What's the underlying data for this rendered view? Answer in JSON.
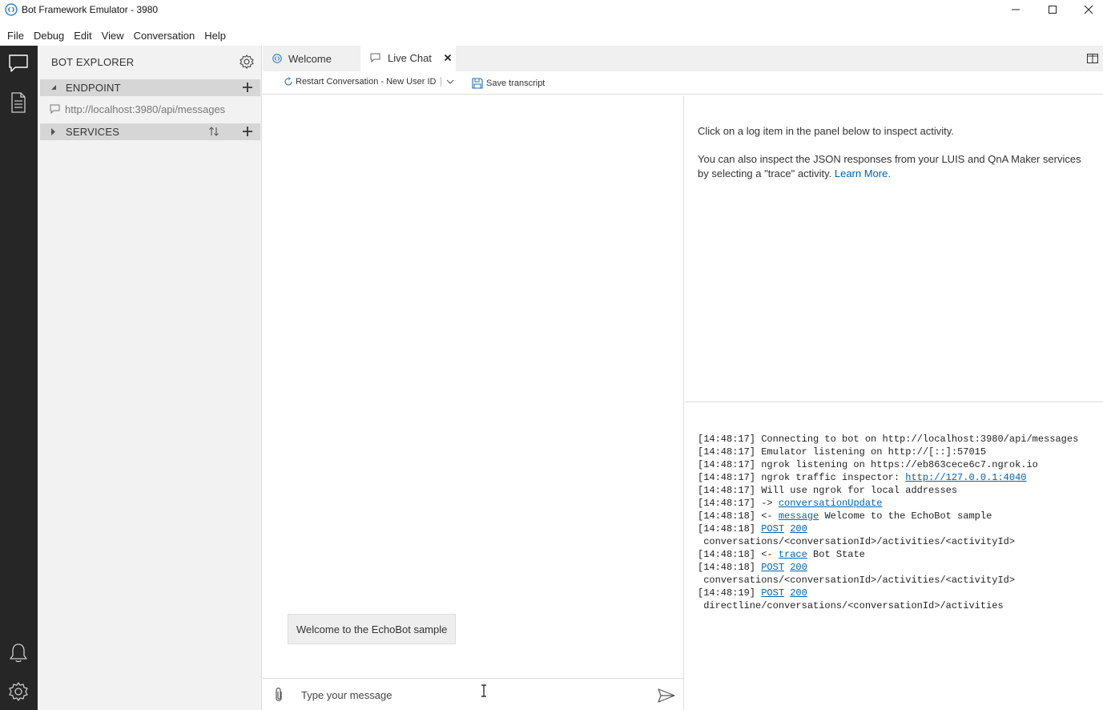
{
  "window": {
    "title": "Bot Framework Emulator - 3980"
  },
  "menu": [
    "File",
    "Debug",
    "Edit",
    "View",
    "Conversation",
    "Help"
  ],
  "explorer": {
    "title": "BOT EXPLORER",
    "endpoint_section": "ENDPOINT",
    "endpoint_url": "http://localhost:3980/api/messages",
    "services_section": "SERVICES"
  },
  "tabs": [
    {
      "label": "Welcome",
      "active": false
    },
    {
      "label": "Live Chat",
      "active": true
    }
  ],
  "toolbar": {
    "restart_label": "Restart Conversation - New User ID",
    "save_label": "Save transcript"
  },
  "chat": {
    "bot_message": "Welcome to the EchoBot sample",
    "input_placeholder": "Type your message"
  },
  "inspector": {
    "line1": "Click on a log item in the panel below to inspect activity.",
    "line2": "You can also inspect the JSON responses from your LUIS and QnA Maker services by selecting a \"trace\" activity.",
    "learn_more": "Learn More."
  },
  "log": [
    {
      "ts": "[14:48:17]",
      "parts": [
        {
          "t": " Connecting to bot on http://localhost:3980/api/messages"
        }
      ]
    },
    {
      "ts": "[14:48:17]",
      "parts": [
        {
          "t": " Emulator listening on http://[::]:57015"
        }
      ]
    },
    {
      "ts": "[14:48:17]",
      "parts": [
        {
          "t": " ngrok listening on https://eb863cece6c7.ngrok.io"
        }
      ]
    },
    {
      "ts": "[14:48:17]",
      "parts": [
        {
          "t": " ngrok traffic inspector: "
        },
        {
          "t": "http://127.0.0.1:4040",
          "link": true
        }
      ]
    },
    {
      "ts": "[14:48:17]",
      "parts": [
        {
          "t": " Will use ngrok for local addresses"
        }
      ]
    },
    {
      "ts": "[14:48:17]",
      "parts": [
        {
          "t": " -> "
        },
        {
          "t": "conversationUpdate",
          "link": true
        }
      ]
    },
    {
      "ts": "[14:48:18]",
      "parts": [
        {
          "t": " <- "
        },
        {
          "t": "message",
          "link": true
        },
        {
          "t": " Welcome to the EchoBot sample"
        }
      ]
    },
    {
      "ts": "[14:48:18]",
      "parts": [
        {
          "t": " "
        },
        {
          "t": "POST",
          "link": true
        },
        {
          "t": " "
        },
        {
          "t": "200",
          "link": true
        }
      ]
    },
    {
      "ts": "",
      "parts": [
        {
          "t": " conversations/<conversationId>/activities/<activityId>"
        }
      ]
    },
    {
      "ts": "[14:48:18]",
      "parts": [
        {
          "t": " <- "
        },
        {
          "t": "trace",
          "link": true
        },
        {
          "t": " Bot State"
        }
      ]
    },
    {
      "ts": "[14:48:18]",
      "parts": [
        {
          "t": " "
        },
        {
          "t": "POST",
          "link": true
        },
        {
          "t": " "
        },
        {
          "t": "200",
          "link": true
        }
      ]
    },
    {
      "ts": "",
      "parts": [
        {
          "t": " conversations/<conversationId>/activities/<activityId>"
        }
      ]
    },
    {
      "ts": "[14:48:19]",
      "parts": [
        {
          "t": " "
        },
        {
          "t": "POST",
          "link": true
        },
        {
          "t": " "
        },
        {
          "t": "200",
          "link": true
        }
      ]
    },
    {
      "ts": "",
      "parts": [
        {
          "t": " directline/conversations/<conversationId>/activities"
        }
      ]
    }
  ],
  "colors": {
    "rail": "#262626",
    "link": "#0063b1",
    "explorer_bg": "#f2f2f2",
    "section_bg": "#d6d6d6"
  },
  "icons": [
    "app-icon",
    "minimize-icon",
    "maximize-icon",
    "close-icon",
    "chat-icon",
    "transcript-icon",
    "bell-icon",
    "settings-icon",
    "gear-icon",
    "add-icon",
    "sort-icon",
    "chat-bubble-icon",
    "restart-icon",
    "chevron-down-icon",
    "save-icon",
    "layout-icon",
    "attach-icon",
    "send-icon"
  ]
}
